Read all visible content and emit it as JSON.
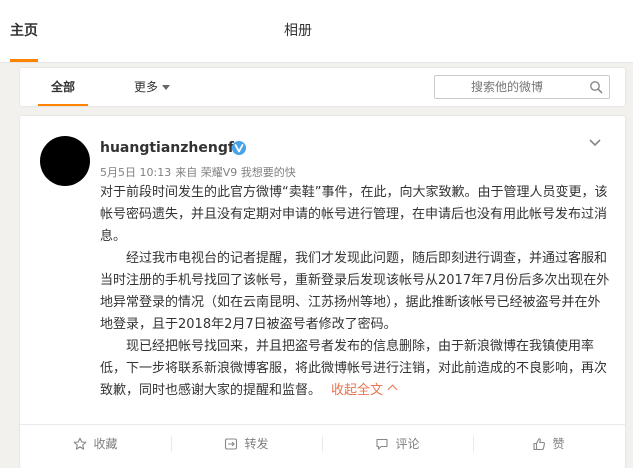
{
  "topnav": {
    "home_label": "主页",
    "album_label": "相册"
  },
  "filter": {
    "all_label": "全部",
    "more_label": "更多",
    "search_placeholder": "搜索他的微博"
  },
  "post": {
    "username": "huangtianzhengfu",
    "date": "5月5日 10:13",
    "source": "来自 荣耀V9 我想要的快",
    "paragraphs": [
      "对于前段时间发生的此官方微博“卖鞋”事件，在此，向大家致歉。由于管理人员变更，该帐号密码遗失，并且没有定期对申请的帐号进行管理，在申请后也没有用此帐号发布过消息。",
      "　　经过我市电视台的记者提醒，我们才发现此问题，随后即刻进行调查，并通过客服和当时注册的手机号找回了该帐号，重新登录后发现该帐号从2017年7月份后多次出现在外地异常登录的情况（如在云南昆明、江苏扬州等地），据此推断该帐号已经被盗号并在外地登录，且于2018年2月7日被盗号者修改了密码。",
      "　　现已经把帐号找回来，并且把盗号者发布的信息删除，由于新浪微博在我镇使用率低，下一步将联系新浪微博客服，将此微博帐号进行注销，对此前造成的不良影响，再次致歉，同时也感谢大家的提醒和监督。"
    ],
    "collapse_label": "收起全文"
  },
  "actions": {
    "favorite": "收藏",
    "repost": "转发",
    "comment": "评论",
    "like": "赞"
  },
  "colors": {
    "accent": "#ff8200",
    "link": "#eb7350",
    "verified": "#47a3e6"
  }
}
